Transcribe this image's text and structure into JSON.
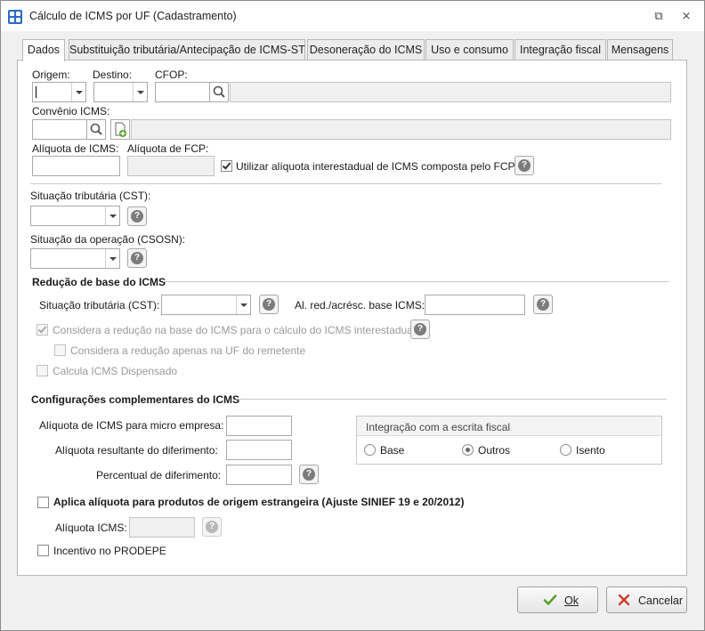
{
  "window": {
    "title": "Cálculo de ICMS por UF (Cadastramento)",
    "restore_icon": "⧉",
    "close_icon": "⨯"
  },
  "tabs": [
    {
      "label": "Dados"
    },
    {
      "label": "Substituição tributária/Antecipação de ICMS-ST"
    },
    {
      "label": "Desoneração do ICMS"
    },
    {
      "label": "Uso e consumo"
    },
    {
      "label": "Integração fiscal"
    },
    {
      "label": "Mensagens"
    }
  ],
  "dados": {
    "origem_label": "Origem:",
    "origem_value": "",
    "destino_label": "Destino:",
    "destino_value": "",
    "cfop_label": "CFOP:",
    "cfop_value": "",
    "cfop_description": "",
    "convenio_label": "Convênio ICMS:",
    "convenio_value": "",
    "convenio_description": "",
    "aliquota_icms_label": "Alíquota de ICMS:",
    "aliquota_icms_value": "",
    "aliquota_fcp_label": "Alíquota de FCP:",
    "aliquota_fcp_value": "",
    "utilizar_composta_label": "Utilizar alíquota interestadual de ICMS composta pelo FCP",
    "utilizar_composta_checked": true,
    "cst_label": "Situação tributária (CST):",
    "cst_value": "",
    "csosn_label": "Situação da operação (CSOSN):",
    "csosn_value": ""
  },
  "reducao": {
    "section_title": "Redução de base do ICMS",
    "cst_label": "Situação tributária (CST):",
    "cst_value": "",
    "al_red_label": "Al. red./acrésc. base ICMS:",
    "al_red_value": "",
    "considera_label": "Considera a redução na base do ICMS para o cálculo do ICMS interestadual",
    "considera_checked": true,
    "considera_remetente_label": "Considera a redução apenas na UF do remetente",
    "considera_remetente_checked": false,
    "calcula_dispensado_label": "Calcula ICMS Dispensado",
    "calcula_dispensado_checked": false
  },
  "complementares": {
    "section_title": "Configurações complementares do ICMS",
    "micro_empresa_label": "Alíquota de ICMS para micro empresa:",
    "micro_empresa_value": "",
    "diferimento_label": "Alíquota resultante do diferimento:",
    "diferimento_value": "",
    "percentual_label": "Percentual de diferimento:",
    "percentual_value": "",
    "integracao_title": "Integração com a escrita fiscal",
    "integracao_options": [
      {
        "label": "Base",
        "selected": false
      },
      {
        "label": "Outros",
        "selected": true
      },
      {
        "label": "Isento",
        "selected": false
      }
    ],
    "aplica_estrangeira_label": "Aplica alíquota para produtos de origem estrangeira (Ajuste SINIEF 19 e 20/2012)",
    "aplica_estrangeira_checked": false,
    "aliquota_icms_label": "Alíquota ICMS:",
    "aliquota_icms_value": "",
    "prodepe_label": "Incentivo no PRODEPE",
    "prodepe_checked": false
  },
  "buttons": {
    "ok_label": "Ok",
    "cancel_label": "Cancelar"
  },
  "colors": {
    "accent_blue": "#2b6cc4",
    "ok_green": "#5aa02c",
    "cancel_red": "#d23a2a"
  }
}
